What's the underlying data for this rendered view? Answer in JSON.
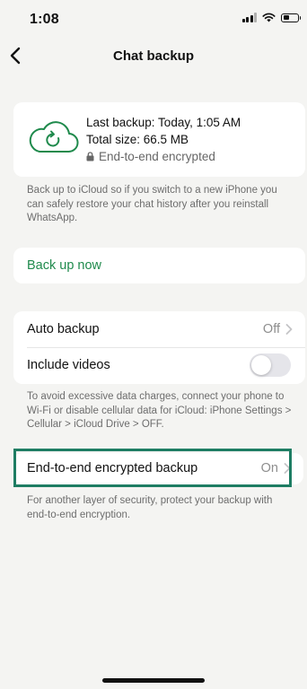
{
  "status_bar": {
    "time": "1:08"
  },
  "nav": {
    "title": "Chat backup"
  },
  "summary": {
    "last_backup": "Last backup: Today, 1:05 AM",
    "total_size": "Total size: 66.5 MB",
    "encryption": "End-to-end encrypted"
  },
  "icloud_note": "Back up to iCloud so if you switch to a new iPhone you can safely restore your chat history after you reinstall WhatsApp.",
  "backup_now": {
    "label": "Back up now"
  },
  "settings": {
    "auto_backup": {
      "label": "Auto backup",
      "value": "Off"
    },
    "include_videos": {
      "label": "Include videos",
      "enabled": false
    }
  },
  "data_note": "To avoid excessive data charges, connect your phone to Wi-Fi or disable cellular data for iCloud: iPhone Settings > Cellular > iCloud Drive > OFF.",
  "e2e_backup": {
    "label": "End-to-end encrypted backup",
    "value": "On"
  },
  "e2e_note": "For another layer of security, protect your backup with end-to-end encryption.",
  "colors": {
    "accent_green": "#1f8a4c",
    "highlight_border": "#1e7d63",
    "background": "#f4f4f2"
  },
  "icons": {
    "back": "chevron-left-icon",
    "cloud": "cloud-sync-icon",
    "lock": "lock-icon",
    "chevron": "chevron-right-icon"
  }
}
